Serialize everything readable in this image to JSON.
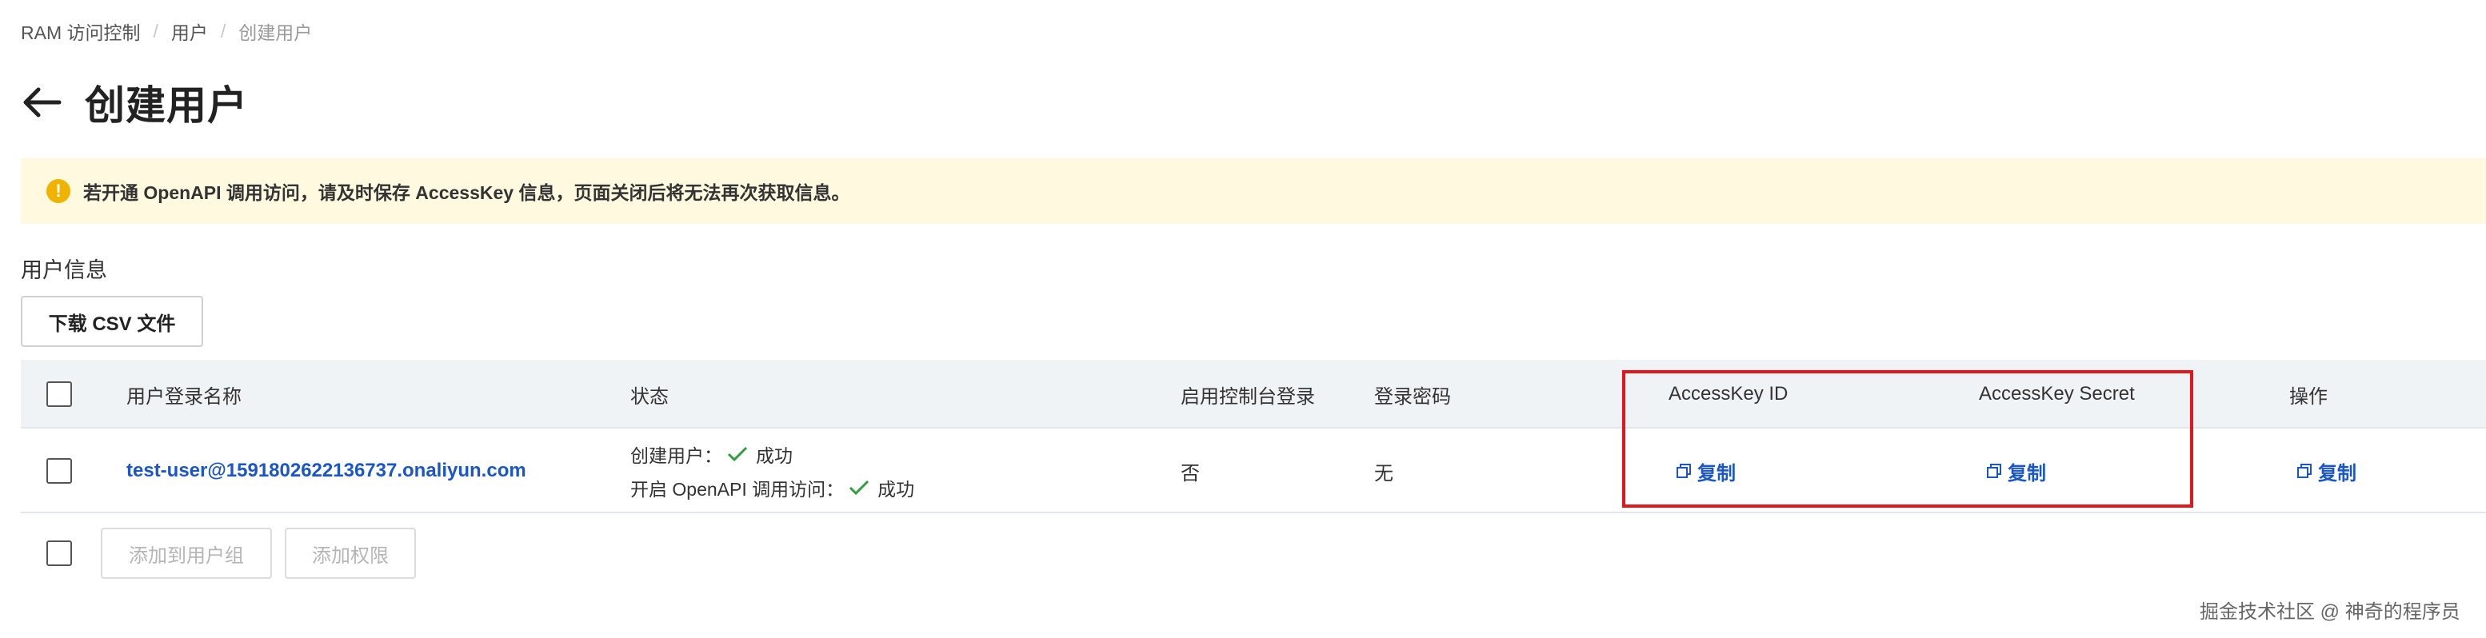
{
  "breadcrumb": {
    "items": [
      "RAM 访问控制",
      "用户",
      "创建用户"
    ],
    "separator": "/"
  },
  "header": {
    "title": "创建用户",
    "back_icon": "arrow-left-icon"
  },
  "alert": {
    "icon": "warning-icon",
    "text": "若开通 OpenAPI 调用访问，请及时保存 AccessKey 信息，页面关闭后将无法再次获取信息。",
    "color": "#fff9e0"
  },
  "section": {
    "title": "用户信息"
  },
  "toolbar": {
    "download_csv_label": "下载 CSV 文件"
  },
  "table": {
    "columns": [
      "用户登录名称",
      "状态",
      "启用控制台登录",
      "登录密码",
      "AccessKey ID",
      "AccessKey Secret",
      "操作"
    ],
    "rows": [
      {
        "login_name": "test-user@1591802622136737.onaliyun.com",
        "status_create_label": "创建用户：",
        "status_create_value": "成功",
        "status_api_label": "开启 OpenAPI 调用访问：",
        "status_api_value": "成功",
        "console_login": "否",
        "password": "无",
        "accesskey_id_action": "复制",
        "accesskey_secret_action": "复制",
        "operation_action": "复制"
      }
    ]
  },
  "footer_actions": {
    "add_to_group_label": "添加到用户组",
    "add_permission_label": "添加权限"
  },
  "watermark": "掘金技术社区 @ 神奇的程序员",
  "colors": {
    "link": "#1a56c8",
    "highlight": "#e3161b",
    "success": "#2e9e3e",
    "warning": "#f0b400"
  }
}
